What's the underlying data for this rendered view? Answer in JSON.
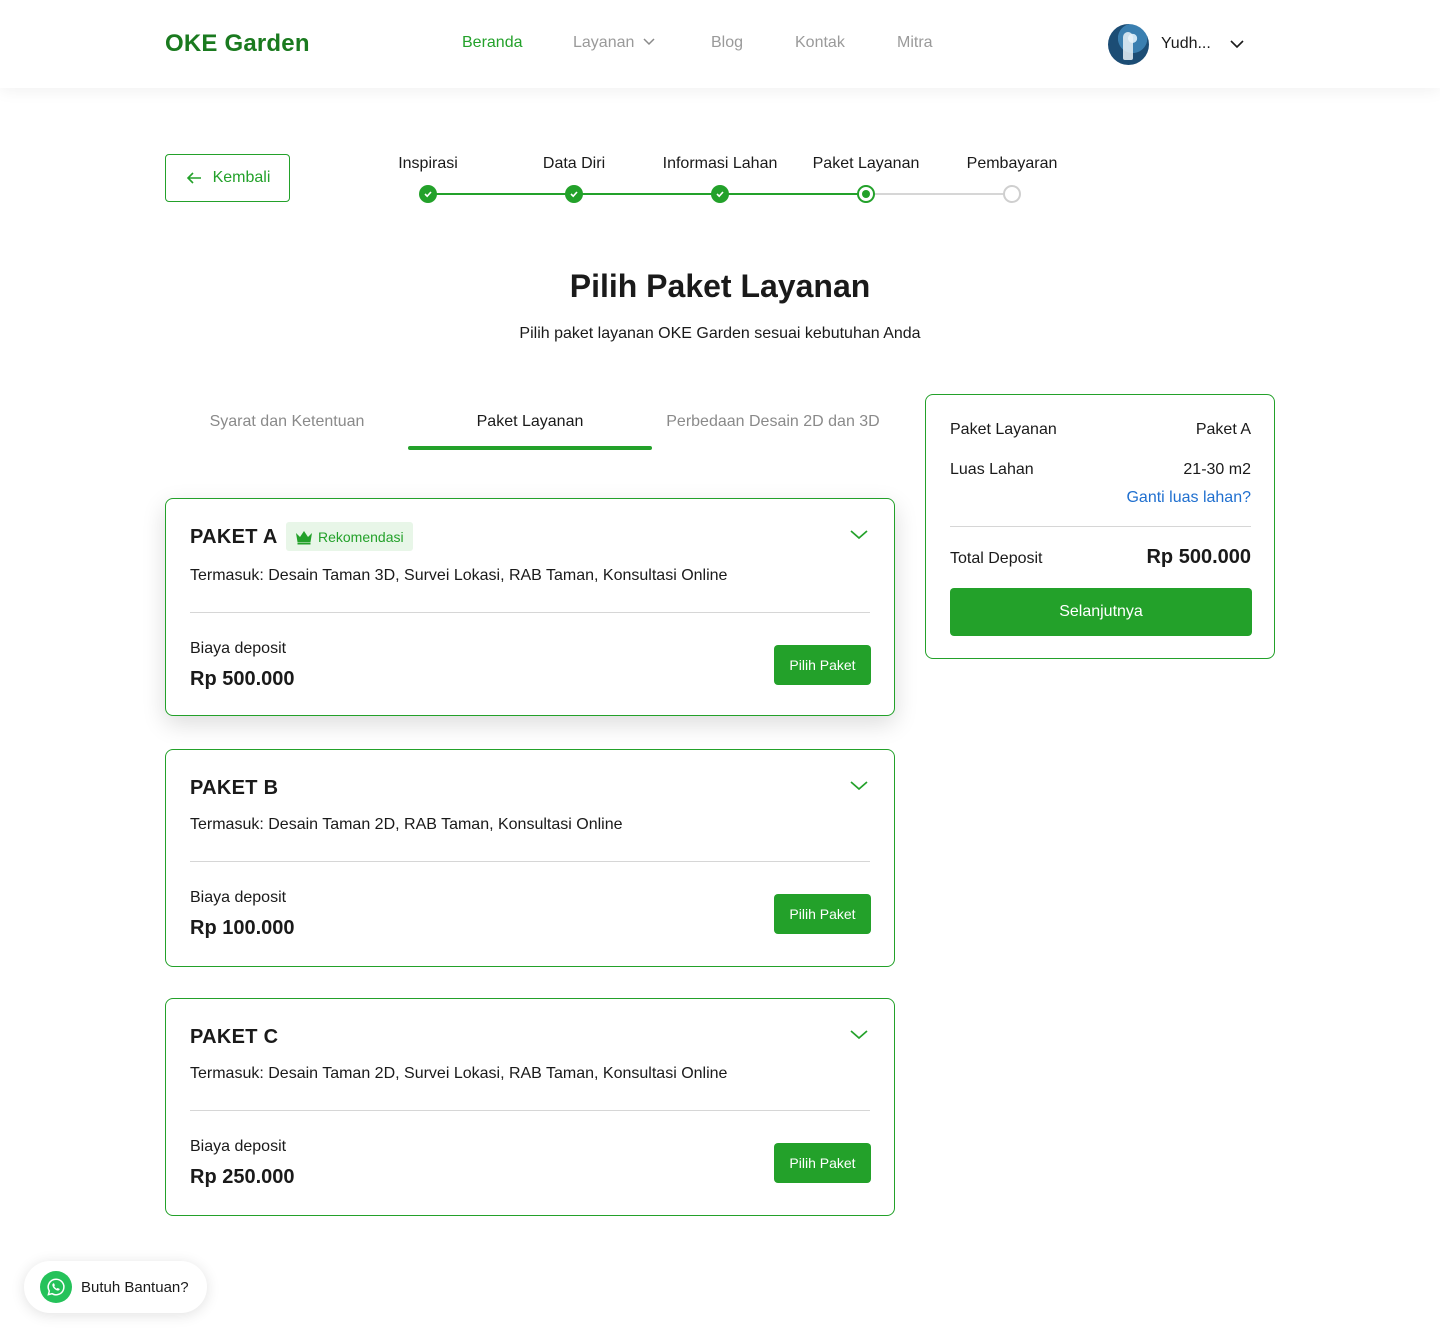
{
  "header": {
    "logo": "OKE Garden",
    "nav": [
      {
        "label": "Beranda",
        "active": true
      },
      {
        "label": "Layanan",
        "has_dropdown": true
      },
      {
        "label": "Blog"
      },
      {
        "label": "Kontak"
      },
      {
        "label": "Mitra"
      }
    ],
    "user_name": "Yudh..."
  },
  "back_label": "Kembali",
  "stepper": {
    "steps": [
      {
        "label": "Inspirasi",
        "state": "done"
      },
      {
        "label": "Data Diri",
        "state": "done"
      },
      {
        "label": "Informasi Lahan",
        "state": "done"
      },
      {
        "label": "Paket Layanan",
        "state": "current"
      },
      {
        "label": "Pembayaran",
        "state": "todo"
      }
    ]
  },
  "title": "Pilih Paket Layanan",
  "subtitle": "Pilih paket layanan OKE Garden sesuai kebutuhan Anda",
  "tabs": [
    {
      "label": "Syarat dan Ketentuan"
    },
    {
      "label": "Paket Layanan",
      "active": true
    },
    {
      "label": "Perbedaan Desain 2D dan 3D"
    }
  ],
  "packages": [
    {
      "name": "PAKET A",
      "badge": "Rekomendasi",
      "includes": "Termasuk: Desain Taman 3D, Survei Lokasi, RAB Taman, Konsultasi Online",
      "price_label": "Biaya deposit",
      "price": "Rp 500.000",
      "button": "Pilih Paket"
    },
    {
      "name": "PAKET B",
      "includes": "Termasuk: Desain Taman 2D, RAB Taman, Konsultasi Online",
      "price_label": "Biaya deposit",
      "price": "Rp 100.000",
      "button": "Pilih Paket"
    },
    {
      "name": "PAKET C",
      "includes": "Termasuk: Desain Taman 2D, Survei Lokasi, RAB Taman, Konsultasi Online",
      "price_label": "Biaya deposit",
      "price": "Rp 250.000",
      "button": "Pilih Paket"
    }
  ],
  "summary": {
    "package_label": "Paket Layanan",
    "package_value": "Paket A",
    "area_label": "Luas Lahan",
    "area_value": "21-30 m2",
    "change_area_link": "Ganti luas lahan?",
    "total_label": "Total Deposit",
    "total_value": "Rp 500.000",
    "next_button": "Selanjutnya"
  },
  "help_label": "Butuh Bantuan?",
  "colors": {
    "brand": "#23a12a",
    "link": "#1f6fcf",
    "text": "#1a1a1a",
    "muted": "#9a9a9a"
  },
  "icons": {
    "back": "arrow-left-icon",
    "chevron": "chevron-down-icon",
    "crown": "crown-icon",
    "check": "check-icon",
    "whatsapp": "whatsapp-icon"
  }
}
